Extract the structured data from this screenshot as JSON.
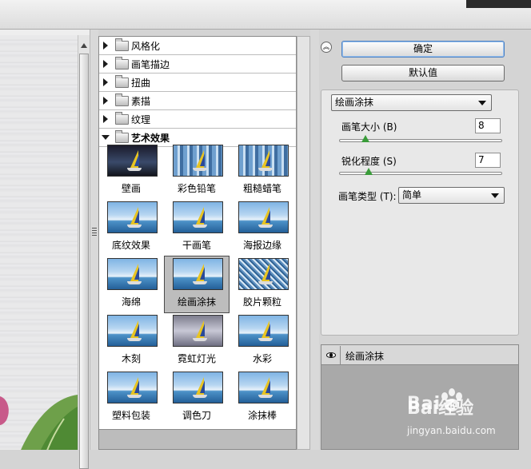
{
  "categories": [
    {
      "label": "风格化",
      "open": false
    },
    {
      "label": "画笔描边",
      "open": false
    },
    {
      "label": "扭曲",
      "open": false
    },
    {
      "label": "素描",
      "open": false
    },
    {
      "label": "纹理",
      "open": false
    },
    {
      "label": "艺术效果",
      "open": true
    }
  ],
  "thumbnails": [
    {
      "label": "壁画",
      "fx": "dark"
    },
    {
      "label": "彩色铅笔",
      "fx": "mosaic"
    },
    {
      "label": "粗糙蜡笔",
      "fx": "mosaic"
    },
    {
      "label": "底纹效果",
      "fx": "plain"
    },
    {
      "label": "干画笔",
      "fx": "plain"
    },
    {
      "label": "海报边缘",
      "fx": "plain"
    },
    {
      "label": "海绵",
      "fx": "plain"
    },
    {
      "label": "绘画涂抹",
      "fx": "plain",
      "selected": true
    },
    {
      "label": "胶片颗粒",
      "fx": "noise"
    },
    {
      "label": "木刻",
      "fx": "plain"
    },
    {
      "label": "霓虹灯光",
      "fx": "gray"
    },
    {
      "label": "水彩",
      "fx": "plain"
    },
    {
      "label": "塑料包装",
      "fx": "plain"
    },
    {
      "label": "调色刀",
      "fx": "plain"
    },
    {
      "label": "涂抹棒",
      "fx": "plain"
    }
  ],
  "buttons": {
    "ok": "确定",
    "default": "默认值"
  },
  "settings": {
    "filter_selected": "绘画涂抹",
    "brush_size": {
      "label": "画笔大小 (B)",
      "value": "8",
      "fraction": 0.16
    },
    "sharpness": {
      "label": "锐化程度 (S)",
      "value": "7",
      "fraction": 0.18
    },
    "brush_type": {
      "label": "画笔类型 (T):",
      "value": "简单"
    }
  },
  "layers": [
    {
      "name": "绘画涂抹",
      "visible": true
    }
  ],
  "watermark": {
    "logo": "Bai经验",
    "url": "jingyan.baidu.com"
  },
  "colors": {
    "accent_button_border": "#4a7fc2",
    "slider_thumb": "#3a9c3a"
  }
}
